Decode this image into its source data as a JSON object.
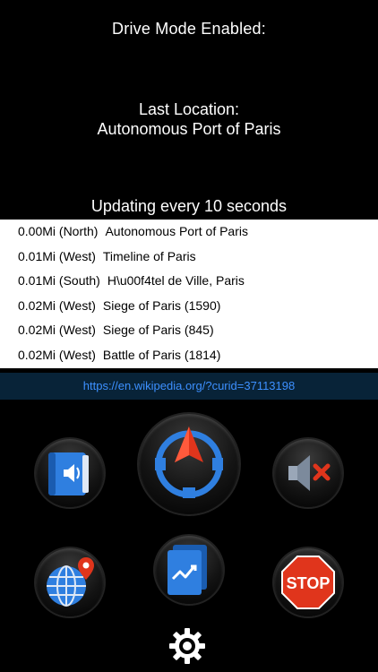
{
  "header": {
    "mode_text": "Drive Mode Enabled:",
    "last_location_label": "Last Location:",
    "last_location_value": "Autonomous Port of Paris",
    "update_text": "Updating every 10 seconds"
  },
  "nearby": [
    {
      "distance": "0.00Mi (North)",
      "name": "Autonomous Port of Paris"
    },
    {
      "distance": "0.01Mi (West)",
      "name": "Timeline of Paris"
    },
    {
      "distance": "0.01Mi (South)",
      "name": "H\\u00f4tel de Ville, Paris"
    },
    {
      "distance": "0.02Mi (West)",
      "name": "Siege of Paris (1590)"
    },
    {
      "distance": "0.02Mi (West)",
      "name": "Siege of Paris (845)"
    },
    {
      "distance": "0.02Mi (West)",
      "name": "Battle of Paris (1814)"
    }
  ],
  "link": {
    "url": "https://en.wikipedia.org/?curid=37113198"
  },
  "buttons": {
    "speak": {
      "icon": "speaker-book-icon"
    },
    "compass": {
      "icon": "compass-arrow-icon"
    },
    "mute": {
      "icon": "mute-speaker-icon"
    },
    "map": {
      "icon": "globe-pin-icon"
    },
    "report": {
      "icon": "document-chart-icon"
    },
    "stop": {
      "icon": "stop-sign-icon",
      "label": "STOP"
    },
    "settings": {
      "icon": "gear-icon"
    }
  },
  "colors": {
    "background": "#000000",
    "list_background": "#ffffff",
    "link_bar": "#082338",
    "link_text": "#3d90ff",
    "accent_blue": "#2f7fe0",
    "accent_red": "#e0351c"
  }
}
